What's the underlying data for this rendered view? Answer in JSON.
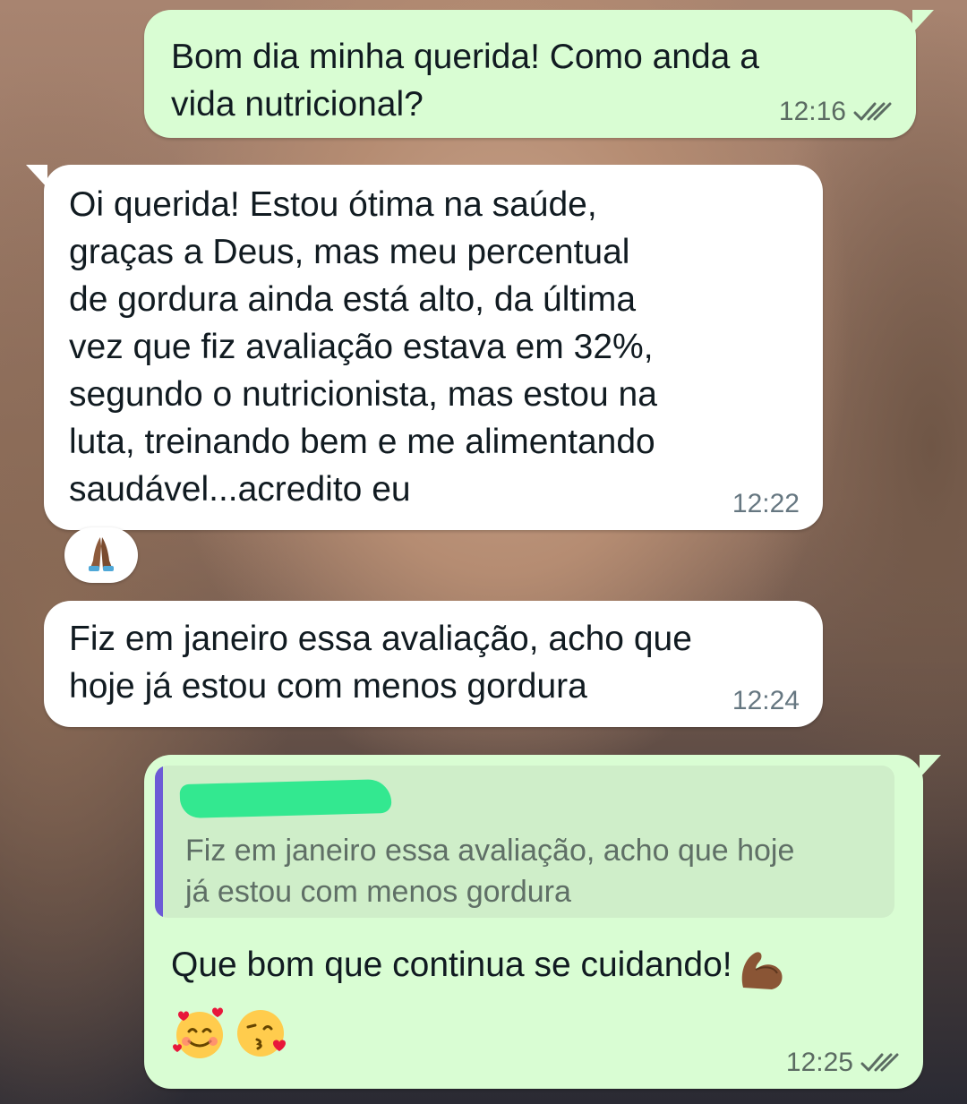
{
  "messages": [
    {
      "direction": "outgoing",
      "text": "Bom dia minha querida! Como anda a\nvida nutricional?",
      "time": "12:16",
      "status": "read"
    },
    {
      "direction": "incoming",
      "text": "Oi querida! Estou ótima na saúde,\ngraças a Deus, mas meu percentual\nde gordura ainda está alto, da última\nvez que fiz avaliação estava em 32%,\nsegundo o nutricionista, mas estou na\nluta, treinando bem e me alimentando\nsaudável...acredito eu",
      "time": "12:22",
      "reaction": "folded-hands"
    },
    {
      "direction": "incoming",
      "text": "Fiz em janeiro essa avaliação, acho que\nhoje já estou com menos gordura",
      "time": "12:24"
    },
    {
      "direction": "outgoing",
      "quoted_text": "Fiz em janeiro essa avaliação, acho que hoje\njá estou com menos gordura",
      "text": "Que bom que continua se cuidando!",
      "emojis": [
        "flexed-biceps",
        "smiling-face-with-hearts",
        "face-blowing-a-kiss"
      ],
      "time": "12:25",
      "status": "read"
    }
  ],
  "colors": {
    "outgoing_bubble": "#d9fdd3",
    "incoming_bubble": "#ffffff",
    "quote_bar": "#6c5bd6",
    "redaction": "#33e890"
  }
}
